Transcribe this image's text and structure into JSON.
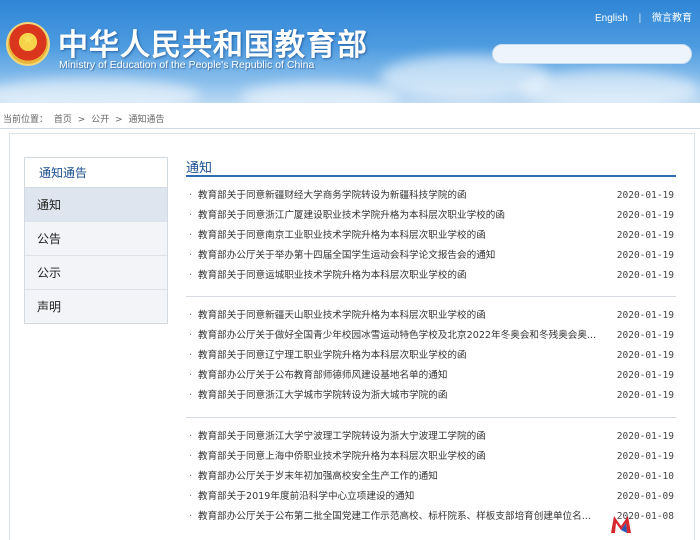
{
  "header": {
    "title": "中华人民共和国教育部",
    "subtitle": "Ministry of Education of the People's Republic of China",
    "links": [
      "English",
      "微言教育"
    ],
    "link_separator": "|"
  },
  "breadcrumb": {
    "label": "当前位置：",
    "items": [
      "首页",
      "公开",
      "通知通告"
    ],
    "separator": ">"
  },
  "sidebar": {
    "title": "通知通告",
    "items": [
      {
        "label": "通知",
        "active": true
      },
      {
        "label": "公告",
        "active": false
      },
      {
        "label": "公示",
        "active": false
      },
      {
        "label": "声明",
        "active": false
      }
    ]
  },
  "main": {
    "section_title": "通知",
    "bullet": "·",
    "groups": [
      [
        {
          "title": "教育部关于同意新疆财经大学商务学院转设为新疆科技学院的函",
          "date": "2020-01-19"
        },
        {
          "title": "教育部关于同意浙江广厦建设职业技术学院升格为本科层次职业学校的函",
          "date": "2020-01-19"
        },
        {
          "title": "教育部关于同意南京工业职业技术学院升格为本科层次职业学校的函",
          "date": "2020-01-19"
        },
        {
          "title": "教育部办公厅关于举办第十四届全国学生运动会科学论文报告会的通知",
          "date": "2020-01-19"
        },
        {
          "title": "教育部关于同意运城职业技术学院升格为本科层次职业学校的函",
          "date": "2020-01-19"
        }
      ],
      [
        {
          "title": "教育部关于同意新疆天山职业技术学院升格为本科层次职业学校的函",
          "date": "2020-01-19"
        },
        {
          "title": "教育部办公厅关于做好全国青少年校园冰雪运动特色学校及北京2022年冬奥会和冬残奥会奥...",
          "date": "2020-01-19"
        },
        {
          "title": "教育部关于同意辽宁理工职业学院升格为本科层次职业学校的函",
          "date": "2020-01-19"
        },
        {
          "title": "教育部办公厅关于公布教育部师德师风建设基地名单的通知",
          "date": "2020-01-19"
        },
        {
          "title": "教育部关于同意浙江大学城市学院转设为浙大城市学院的函",
          "date": "2020-01-19"
        }
      ],
      [
        {
          "title": "教育部关于同意浙江大学宁波理工学院转设为浙大宁波理工学院的函",
          "date": "2020-01-19"
        },
        {
          "title": "教育部关于同意上海中侨职业技术学院升格为本科层次职业学校的函",
          "date": "2020-01-19"
        },
        {
          "title": "教育部办公厅关于岁末年初加强高校安全生产工作的通知",
          "date": "2020-01-10"
        },
        {
          "title": "教育部关于2019年度前沿科学中心立项建设的通知",
          "date": "2020-01-09"
        },
        {
          "title": "教育部办公厅关于公布第二批全国党建工作示范高校、标杆院系、样板支部培育创建单位名...",
          "date": "2020-01-08"
        }
      ]
    ]
  },
  "colors": {
    "header_blue": "#2f86d6",
    "link_blue": "#1b4f8f",
    "rule_blue": "#2f6cb3"
  }
}
